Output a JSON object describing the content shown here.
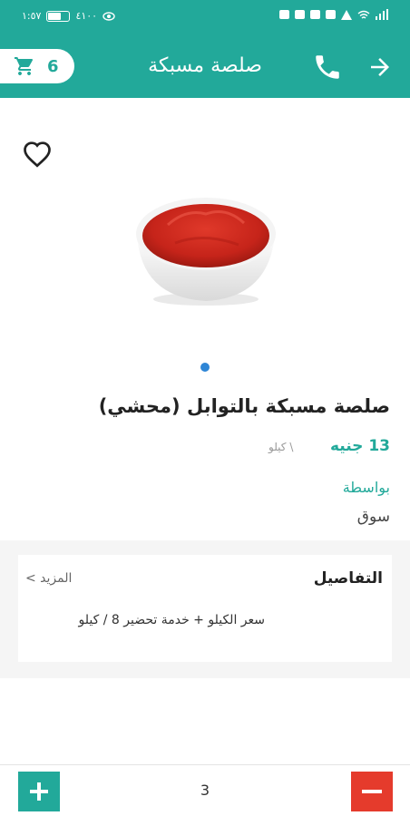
{
  "status_bar": {
    "time": "١:٥٧",
    "speed": "٤١٠٠"
  },
  "app_bar": {
    "title": "صلصة مسبكة",
    "cart_count": "6",
    "icons": [
      "cart-icon",
      "phone-icon",
      "arrow-right-icon"
    ]
  },
  "product": {
    "name": "صلصة مسبكة بالتوابل (محشي)",
    "price": "13 جنيه",
    "unit": "\\ كيلو",
    "by_label": "بواسطة",
    "by_value": "سوق",
    "favorite_icon": "heart-outline-icon"
  },
  "details": {
    "title": "التفاصيل",
    "more": "المزيد >",
    "text": "سعر الكيلو + خدمة تحضير 8 / كيلو"
  },
  "quantity": {
    "value": "3",
    "plus_icon": "plus-icon",
    "minus_icon": "minus-icon"
  },
  "colors": {
    "primary": "#22a99a",
    "danger": "#e53b2c",
    "dot": "#2f86d6"
  }
}
